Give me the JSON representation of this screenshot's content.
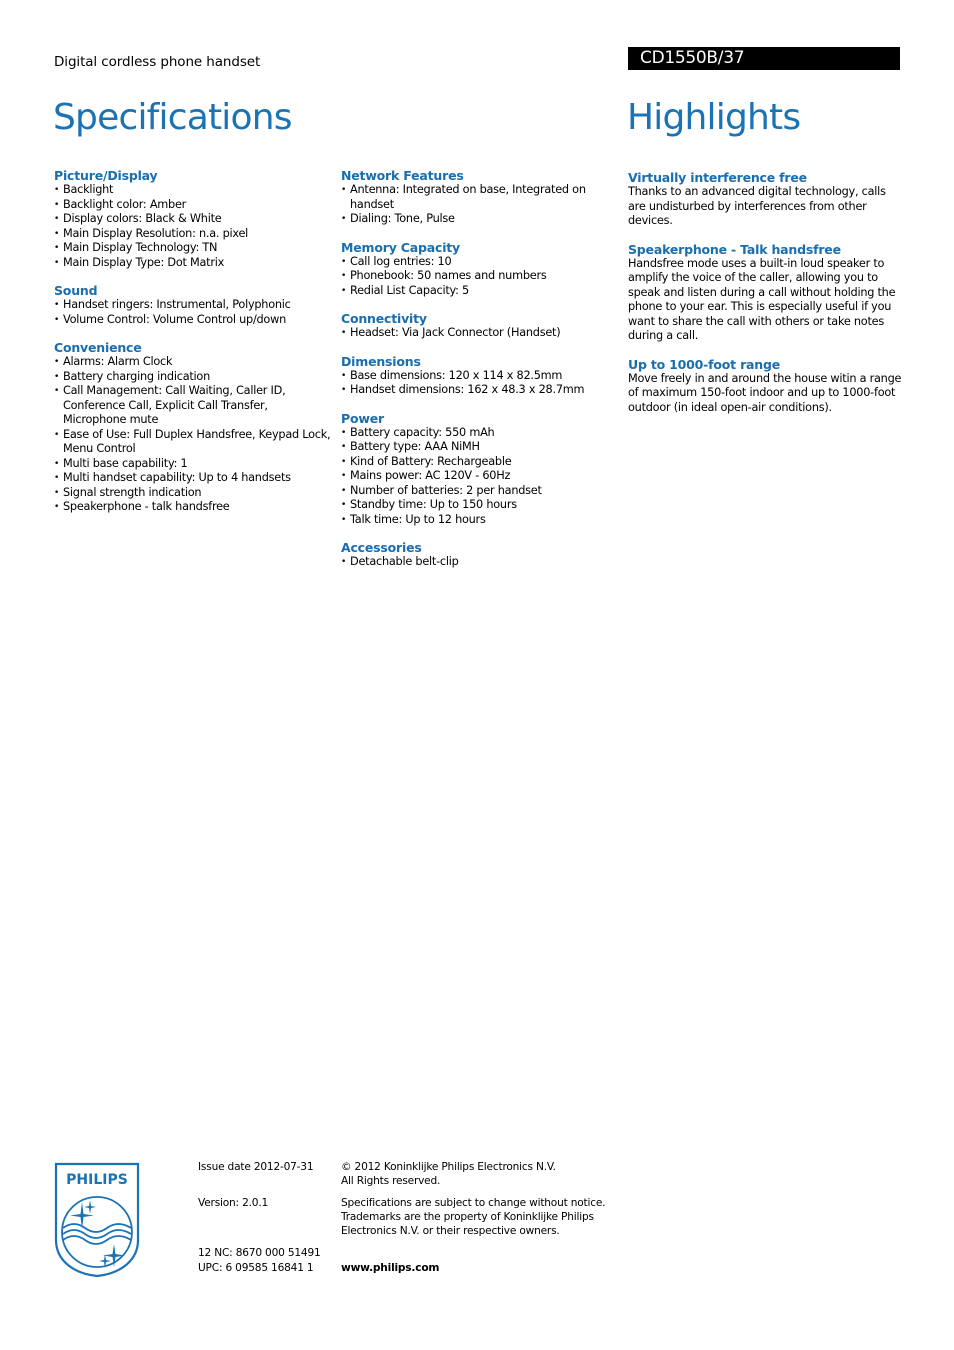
{
  "header": {
    "product_type": "Digital cordless phone handset",
    "model": "CD1550B/37"
  },
  "specifications": {
    "title": "Specifications",
    "column1": [
      {
        "title": "Picture/Display",
        "items": [
          "Backlight",
          "Backlight color: Amber",
          "Display colors: Black & White",
          "Main Display Resolution: n.a. pixel",
          "Main Display Technology: TN",
          "Main Display Type: Dot Matrix"
        ]
      },
      {
        "title": "Sound",
        "items": [
          "Handset ringers: Instrumental, Polyphonic",
          "Volume Control: Volume Control up/down"
        ]
      },
      {
        "title": "Convenience",
        "items": [
          "Alarms: Alarm Clock",
          "Battery charging indication",
          "Call Management: Call Waiting, Caller ID, Conference Call, Explicit Call Transfer, Microphone mute",
          "Ease of Use: Full Duplex Handsfree, Keypad Lock, Menu Control",
          "Multi base capability: 1",
          "Multi handset capability: Up to 4 handsets",
          "Signal strength indication",
          "Speakerphone - talk handsfree"
        ]
      }
    ],
    "column2": [
      {
        "title": "Network Features",
        "items": [
          "Antenna: Integrated on base, Integrated on handset",
          "Dialing: Tone, Pulse"
        ]
      },
      {
        "title": "Memory Capacity",
        "items": [
          "Call log entries: 10",
          "Phonebook: 50 names and numbers",
          "Redial List Capacity: 5"
        ]
      },
      {
        "title": "Connectivity",
        "items": [
          "Headset: Via Jack Connector (Handset)"
        ]
      },
      {
        "title": "Dimensions",
        "items": [
          "Base dimensions: 120 x 114 x 82.5mm",
          "Handset dimensions: 162 x 48.3 x 28.7mm"
        ]
      },
      {
        "title": "Power",
        "items": [
          "Battery capacity: 550 mAh",
          "Battery type: AAA NiMH",
          "Kind of Battery: Rechargeable",
          "Mains power: AC 120V - 60Hz",
          "Number of batteries: 2 per handset",
          "Standby time: Up to 150 hours",
          "Talk time: Up to 12 hours"
        ]
      },
      {
        "title": "Accessories",
        "items": [
          "Detachable belt-clip"
        ]
      }
    ]
  },
  "highlights": {
    "title": "Highlights",
    "items": [
      {
        "title": "Virtually interference free",
        "text": "Thanks to an advanced digital technology, calls are undisturbed by interferences from other devices."
      },
      {
        "title": "Speakerphone - Talk handsfree",
        "text": "Handsfree mode uses a built-in loud speaker to amplify the voice of the caller, allowing you to speak and listen during a call without holding the phone to your ear. This is especially useful if you want to share the call with others or take notes during a call."
      },
      {
        "title": "Up to 1000-foot range",
        "text": "Move freely in and around the house witin a range of maximum 150-foot indoor and up to 1000-foot outdoor (in ideal open-air conditions)."
      }
    ]
  },
  "footer": {
    "logo_text": "PHILIPS",
    "issue_date": "Issue date 2012-07-31",
    "version": "Version: 2.0.1",
    "nc": "12 NC: 8670 000 51491",
    "upc": "UPC: 6 09585 16841 1",
    "copyright_line1": "© 2012 Koninklijke Philips Electronics N.V.",
    "copyright_line2": "All Rights reserved.",
    "disclaimer": "Specifications are subject to change without notice. Trademarks are the property of Koninklijke Philips Electronics N.V. or their respective owners.",
    "website": "www.philips.com"
  },
  "colors": {
    "accent": "#1a73b5",
    "model_bar": "#000000"
  }
}
